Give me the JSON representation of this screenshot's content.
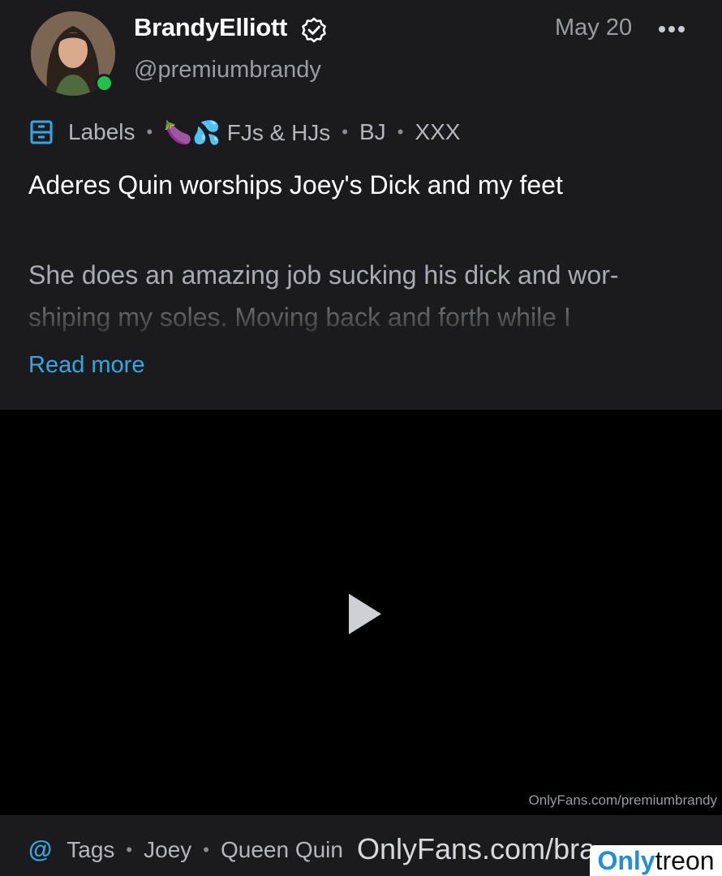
{
  "author": {
    "display_name": "BrandyElliott",
    "handle": "@premiumbrandy",
    "online": true,
    "verified": true
  },
  "post": {
    "date": "May 20",
    "labels_title": "Labels",
    "labels": [
      "🍆💦 FJs & HJs",
      "BJ",
      "XXX"
    ],
    "title": "Aderes Quin worships Joey's Dick and my feet",
    "body": "She does an amazing job sucking his dick and wor-shiping my soles. Moving back and forth while I",
    "read_more": "Read more"
  },
  "video": {
    "watermark": "OnlyFans.com/premiumbrandy"
  },
  "tags": {
    "title": "Tags",
    "items": [
      "Joey",
      "Queen Quin"
    ]
  },
  "overlay": {
    "url_text": "OnlyFans.com/bra",
    "brand_left": "Only",
    "brand_right": "treon"
  },
  "icons": {
    "labels": "archive-drawer-icon",
    "tags": "at-sign-icon",
    "more": "more-horizontal-icon",
    "play": "play-icon",
    "verified": "verified-badge-icon"
  },
  "colors": {
    "accent": "#2fa8e3",
    "online": "#1fc24a",
    "background": "#1b1b1d"
  }
}
